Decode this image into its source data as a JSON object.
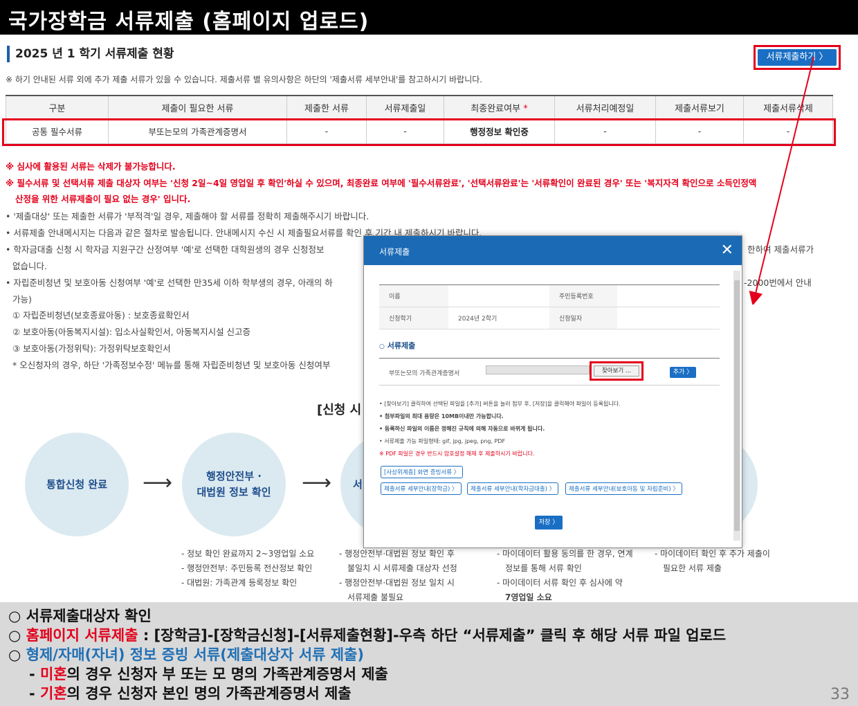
{
  "title": "국가장학금 서류제출 (홈페이지 업로드)",
  "section_heading": "2025 년 1 학기 서류제출 현황",
  "submit_button": "서류제출하기 〉",
  "notice": "※ 하기 안내된 서류 외에 추가 제출 서류가 있을 수 있습니다. 제출서류 별 유의사항은 하단의 '제출서류 세부안내'를 참고하시기 바랍니다.",
  "table": {
    "headers": [
      "구분",
      "제출이 필요한 서류",
      "제출한 서류",
      "서류제출일",
      "최종완료여부",
      "서류처리예정일",
      "제출서류보기",
      "제출서류삭제"
    ],
    "required_mark": "*",
    "row": [
      "공통 필수서류",
      "부또는모의 가족관계증명서",
      "-",
      "-",
      "행정정보 확인중",
      "-",
      "-",
      "-"
    ]
  },
  "warnings": [
    "※ 심사에 활용된 서류는 삭제가 불가능합니다.",
    "※ 필수서류 및 선택서류 제출 대상자 여부는 '신청 2일~4일 영업일 후 확인'하실 수 있으며, 최종완료 여부에 '필수서류완료', '선택서류완료'는 '서류확인이 완료된 경우' 또는 '복지자격 확인으로 소득인정액",
    "산정을 위한 서류제출이 필요 없는 경우' 입니다."
  ],
  "info_lines": [
    "• '제출대상' 또는 제출한 서류가 '부적격'일 경우, 제출해야 할 서류를 정확히 제출해주시기 바랍니다.",
    "• 서류제출 안내메시지는 다음과 같은 절차로 발송됩니다. 안내메시지 수신 시 제출필요서류를 확인 후 기간 내 제출하시기 바랍니다.",
    "• 학자금대출 신청 시 학자금 지원구간 산정여부 '예'로 선택한 대학원생의 경우 신청정보",
    "한하여 제출서류가",
    "없습니다.",
    "• 자립준비청년 및 보호아동 신청여부 '예'로 선택한 만35세 이하 학부생의 경우, 아래의 하",
    "-2000번에서 안내",
    "가능)",
    "① 자립준비청년(보호종료아동) : 보호종료확인서",
    "② 보호아동(아동복지시설): 입소사실확인서, 아동복지시설 신고증",
    "③ 보호아동(가정위탁): 가정위탁보호확인서",
    "* 오신청자의 경우, 하단 '가족정보수정' 메뉴를 통해 자립준비청년 및 보호아동 신청여부"
  ],
  "process_title": "[신청 시",
  "steps": [
    {
      "label1": "통합신청 완료",
      "label2": ""
    },
    {
      "label1": "행정안전부 ·",
      "label2": "대법원 정보 확인"
    },
    {
      "label1": "서",
      "label2": ""
    }
  ],
  "step_notes": [
    [
      "- 정보 확인 완료까지 2~3영업일 소요",
      "- 행정안전부: 주민등록 전산정보 확인",
      "- 대법원: 가족관계 등록정보 확인"
    ],
    [
      "- 행정안전부·대법원 정보 확인 후",
      "불일치 시 서류제출 대상자 선정",
      "- 행정안전부·대법원 정보 일치 시",
      "서류제출 불필요"
    ],
    [
      "- 마이데이터 활용 동의를 한 경우, 연계",
      "정보를 통해 서류 확인",
      "- 마이데이터 서류 확인 후 심사에 약",
      "7영업일 소요"
    ],
    [
      "- 마이데이터 확인 후 추가 제출이",
      "필요한 서류 제출"
    ]
  ],
  "modal": {
    "title": "서류제출",
    "close": "✕",
    "info_labels": [
      "이름",
      "주민등록번호",
      "신청학기",
      "2024년 2학기",
      "신청일자"
    ],
    "section": "서류제출",
    "doc_name": "부또는모의 가족관계증명서",
    "browse": "찾아보기 ...",
    "add": "추가 〉",
    "guide": [
      "• [찾아보기] 클릭하여 선택된 파일을 [추가] 버튼을 눌러 첨부 후, [저장]을 클릭해야 파일이 등록됩니다.",
      "• 첨부파일의 최대 용량은 10MB이내만 가능합니다.",
      "• 등록하신 파일의 이름은 정해진 규칙에 의해 자동으로 바뀌게 됩니다.",
      "• 서류제출 가능 파일형태: gif, jpg, jpeg, png, PDF",
      "※ PDF 파일은 경우 반드시 암호설정 해제 후 제출하시기 바랍니다."
    ],
    "links": [
      "[사상위계층] 화면 증빙서류 〉",
      "제출서류 세부안내(장학금) 〉",
      "제출서류 세부안내(학자금대출) 〉",
      "제출서류 세부안내(보호아동 및 자립준비) 〉"
    ],
    "save": "저장 〉"
  },
  "bottom": {
    "line1": "○ 서류제출대상자 확인",
    "line2_prefix": "○ ",
    "line2_red": "홈페이지 서류제출",
    "line2_rest": " : [장학금]-[장학금신청]-[서류제출현황]-우측 하단 “서류제출” 클릭 후 해당 서류 파일 업로드",
    "line3_prefix": "○ ",
    "line3_blue": "형제/자매(자녀) 정보 증빙 서류(제출대상자 서류 제출)",
    "line4_prefix": "- ",
    "line4_red": "미혼",
    "line4_rest": "의 경우 신청자 부 또는 모 명의 가족관계증명서 제출",
    "line5_prefix": "- ",
    "line5_red": "기혼",
    "line5_rest": "의 경우 신청자 본인 명의 가족관계증명서 제출",
    "page": "33"
  },
  "colors": {
    "brand_blue": "#1a6fc4",
    "highlight_red": "#e3001b",
    "circle_bg": "#dbe9f0"
  }
}
